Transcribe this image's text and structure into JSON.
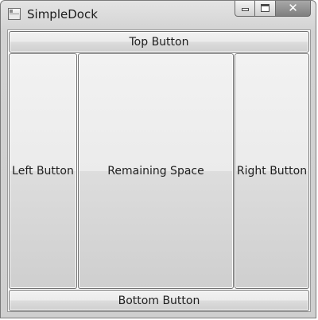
{
  "window": {
    "title": "SimpleDock",
    "caption_buttons": {
      "minimize": "minimize-icon",
      "maximize": "maximize-icon",
      "close": "close-icon",
      "close_glyph": "✕"
    }
  },
  "dock": {
    "top_label": "Top Button",
    "left_label": "Left Button",
    "center_label": "Remaining Space",
    "right_label": "Right Button",
    "bottom_label": "Bottom Button"
  },
  "colors": {
    "button_face_top": "#f2f2f2",
    "button_face_bottom": "#cfcfcf",
    "button_border": "#707070",
    "client_background": "#ffffff"
  }
}
